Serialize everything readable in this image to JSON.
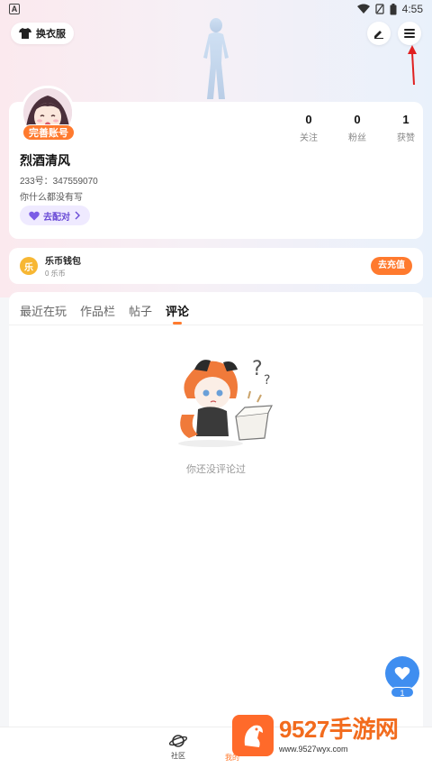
{
  "status_bar": {
    "app_letter": "A",
    "time": "4:55"
  },
  "header": {
    "outfit_button": "换衣服"
  },
  "profile": {
    "complete_account": "完善账号",
    "stats": [
      {
        "value": "0",
        "label": "关注"
      },
      {
        "value": "0",
        "label": "粉丝"
      },
      {
        "value": "1",
        "label": "获赞"
      }
    ],
    "username": "烈酒清风",
    "uid": "233号：347559070",
    "bio": "你什么都没有写",
    "pair_button": "去配对"
  },
  "wallet": {
    "coin_glyph": "乐",
    "title": "乐币钱包",
    "balance": "0 乐币",
    "recharge": "去充值"
  },
  "tabs": [
    {
      "label": "最近在玩",
      "active": false
    },
    {
      "label": "作品栏",
      "active": false
    },
    {
      "label": "帖子",
      "active": false
    },
    {
      "label": "评论",
      "active": true
    }
  ],
  "empty_state": {
    "text": "你还没评论过"
  },
  "like_fab": {
    "count": "1"
  },
  "bottom_nav": {
    "community": "社区",
    "mine": "我的"
  },
  "watermark": {
    "title": "9527手游网",
    "url": "www.9527wyx.com"
  },
  "colors": {
    "accent": "#ff7a2e",
    "like_blue": "#3f8ef0",
    "pair_purple": "#6a4bd6"
  }
}
